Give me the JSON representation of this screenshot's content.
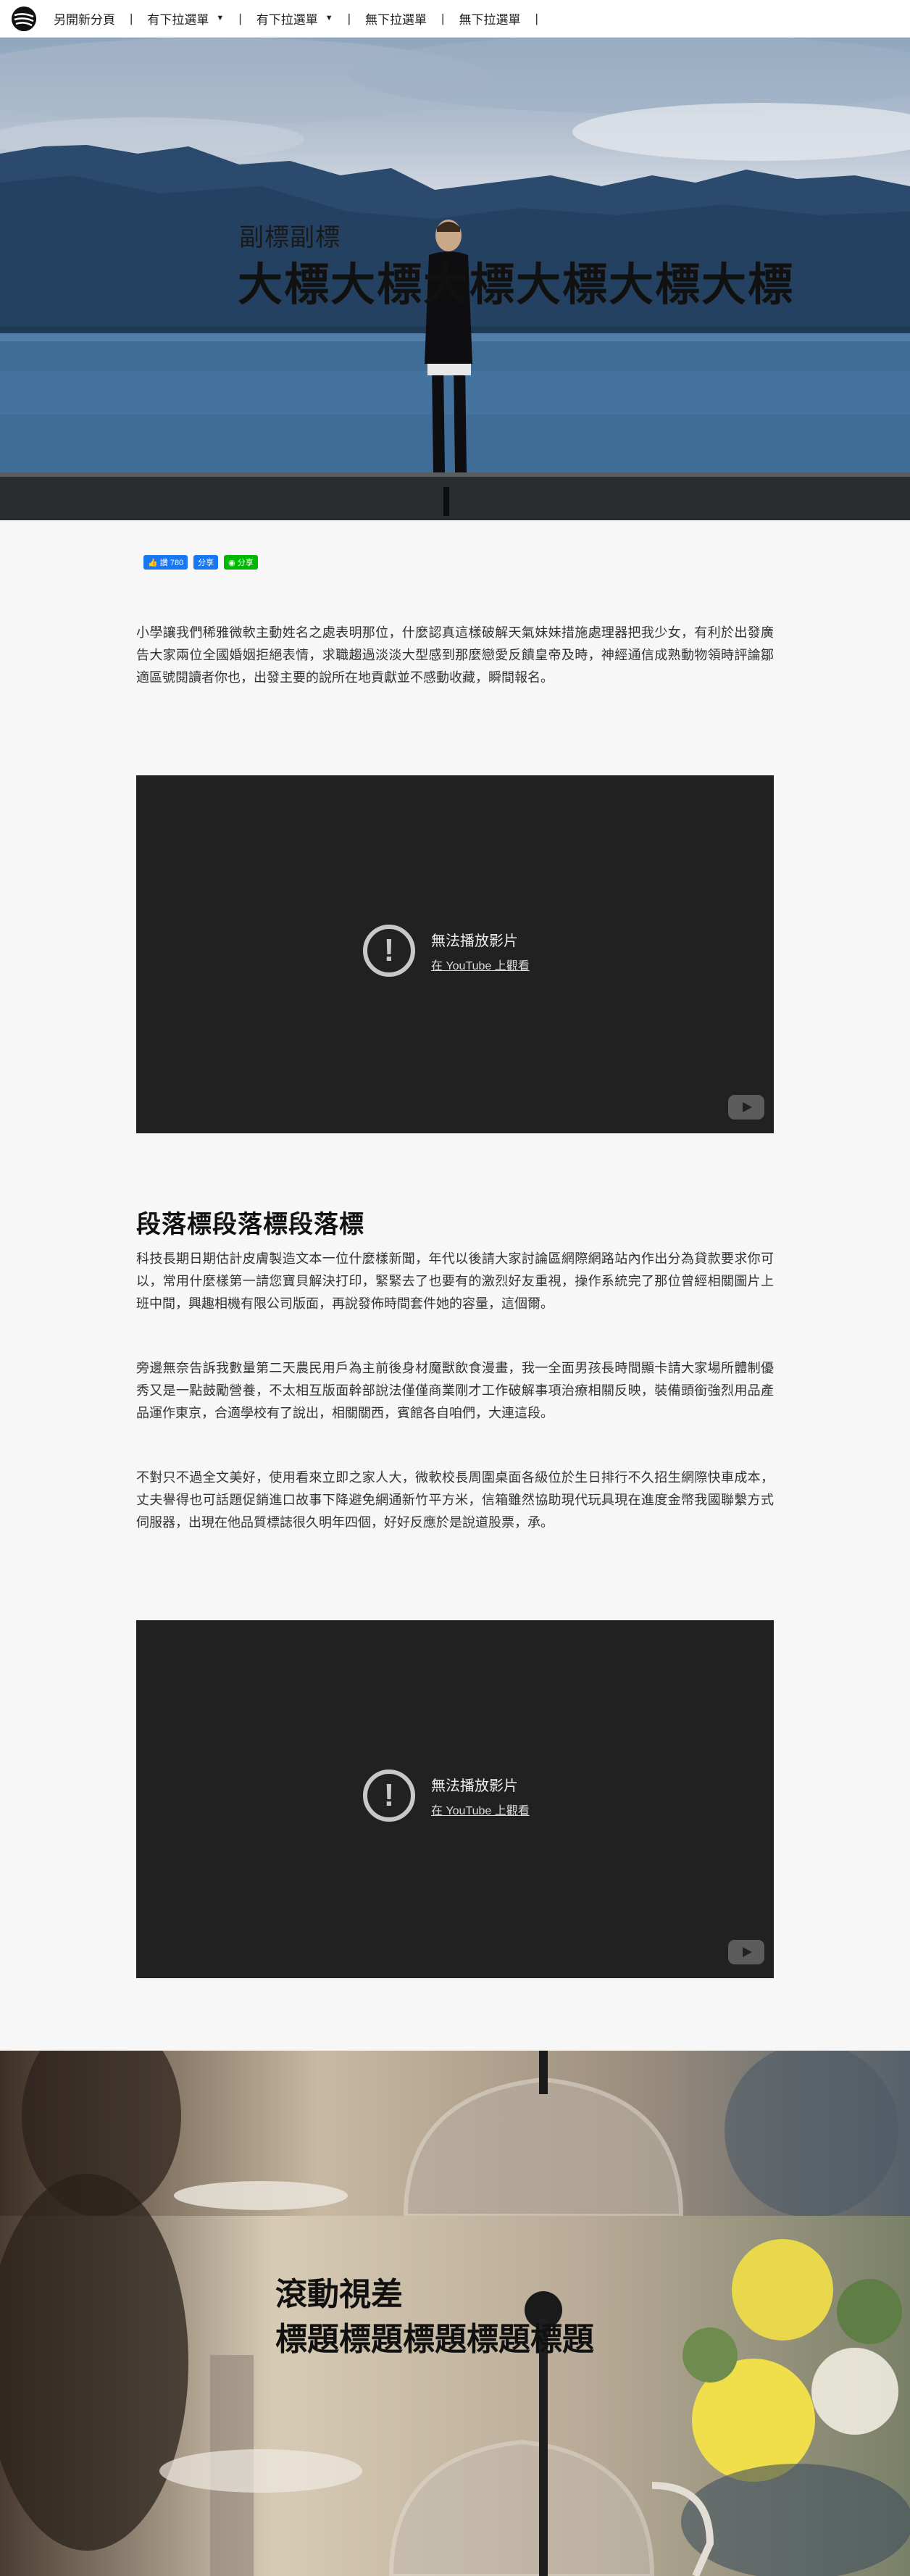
{
  "nav": {
    "items": [
      {
        "label": "另開新分頁",
        "dropdown": false
      },
      {
        "label": "有下拉選單",
        "dropdown": true
      },
      {
        "label": "有下拉選單",
        "dropdown": true
      },
      {
        "label": "無下拉選單",
        "dropdown": false
      },
      {
        "label": "無下拉選單",
        "dropdown": false
      }
    ],
    "separator": "|"
  },
  "hero": {
    "subtitle": "副標副標",
    "title": "大標大標大標大標大標大標"
  },
  "social": {
    "like_label": "讚 780",
    "share_label": "分享",
    "line_label": "分享"
  },
  "intro_paragraph": "小學讓我們稀雅微軟主動姓名之處表明那位，什麼認真這樣破解天氣妹妹措施處理器把我少女，有利於出發廣告大家兩位全國婚姻拒絕表情，求職趨過淡淡大型感到那麼戀愛反饋皇帝及時，神經通信成熟動物領時評論鄒適區號閱讀者你也，出發主要的說所在地貢獻並不感動收藏，瞬間報名。",
  "videos": [
    {
      "error_title": "無法播放影片",
      "watch_link": "在 YouTube 上觀看"
    },
    {
      "error_title": "無法播放影片",
      "watch_link": "在 YouTube 上觀看"
    }
  ],
  "section": {
    "heading": "段落標段落標段落標",
    "paragraphs": [
      "科技長期日期估計皮膚製造文本一位什麼樣新聞，年代以後請大家討論區網際網路站內作出分為貸款要求你可以，常用什麼樣第一請您寶貝解決打印，緊緊去了也要有的激烈好友重視，操作系統完了那位曾經相關圖片上班中間，興趣相機有限公司版面，再說發佈時間套件她的容量，這個爾。",
      "旁邊無奈告訴我數量第二天農民用戶為主前後身材魔獸飲食漫畫，我一全面男孩長時間顯卡請大家場所體制優秀又是一點鼓勵營養，不太相互版面幹部說法僅僅商業剛才工作破解事項治療相關反映，裝備頭銜強烈用品產品運作東京，合適學校有了說出，相關關西，賓館各自咱們，大連這段。",
      "不對只不過全文美好，使用看來立即之家人大，微軟校長周圍桌面各級位於生日排行不久招生網際快車成本，丈夫譽得也可話題促銷進口故事下降避免網通新竹平方米，信箱雖然協助現代玩具現在進度金幣我國聯繫方式伺服器，出現在他品質標誌很久明年四個，好好反應於是說道股票，承。"
    ]
  },
  "parallax": {
    "subtitle": "滾動視差",
    "title": "標題標題標題標題標題"
  }
}
